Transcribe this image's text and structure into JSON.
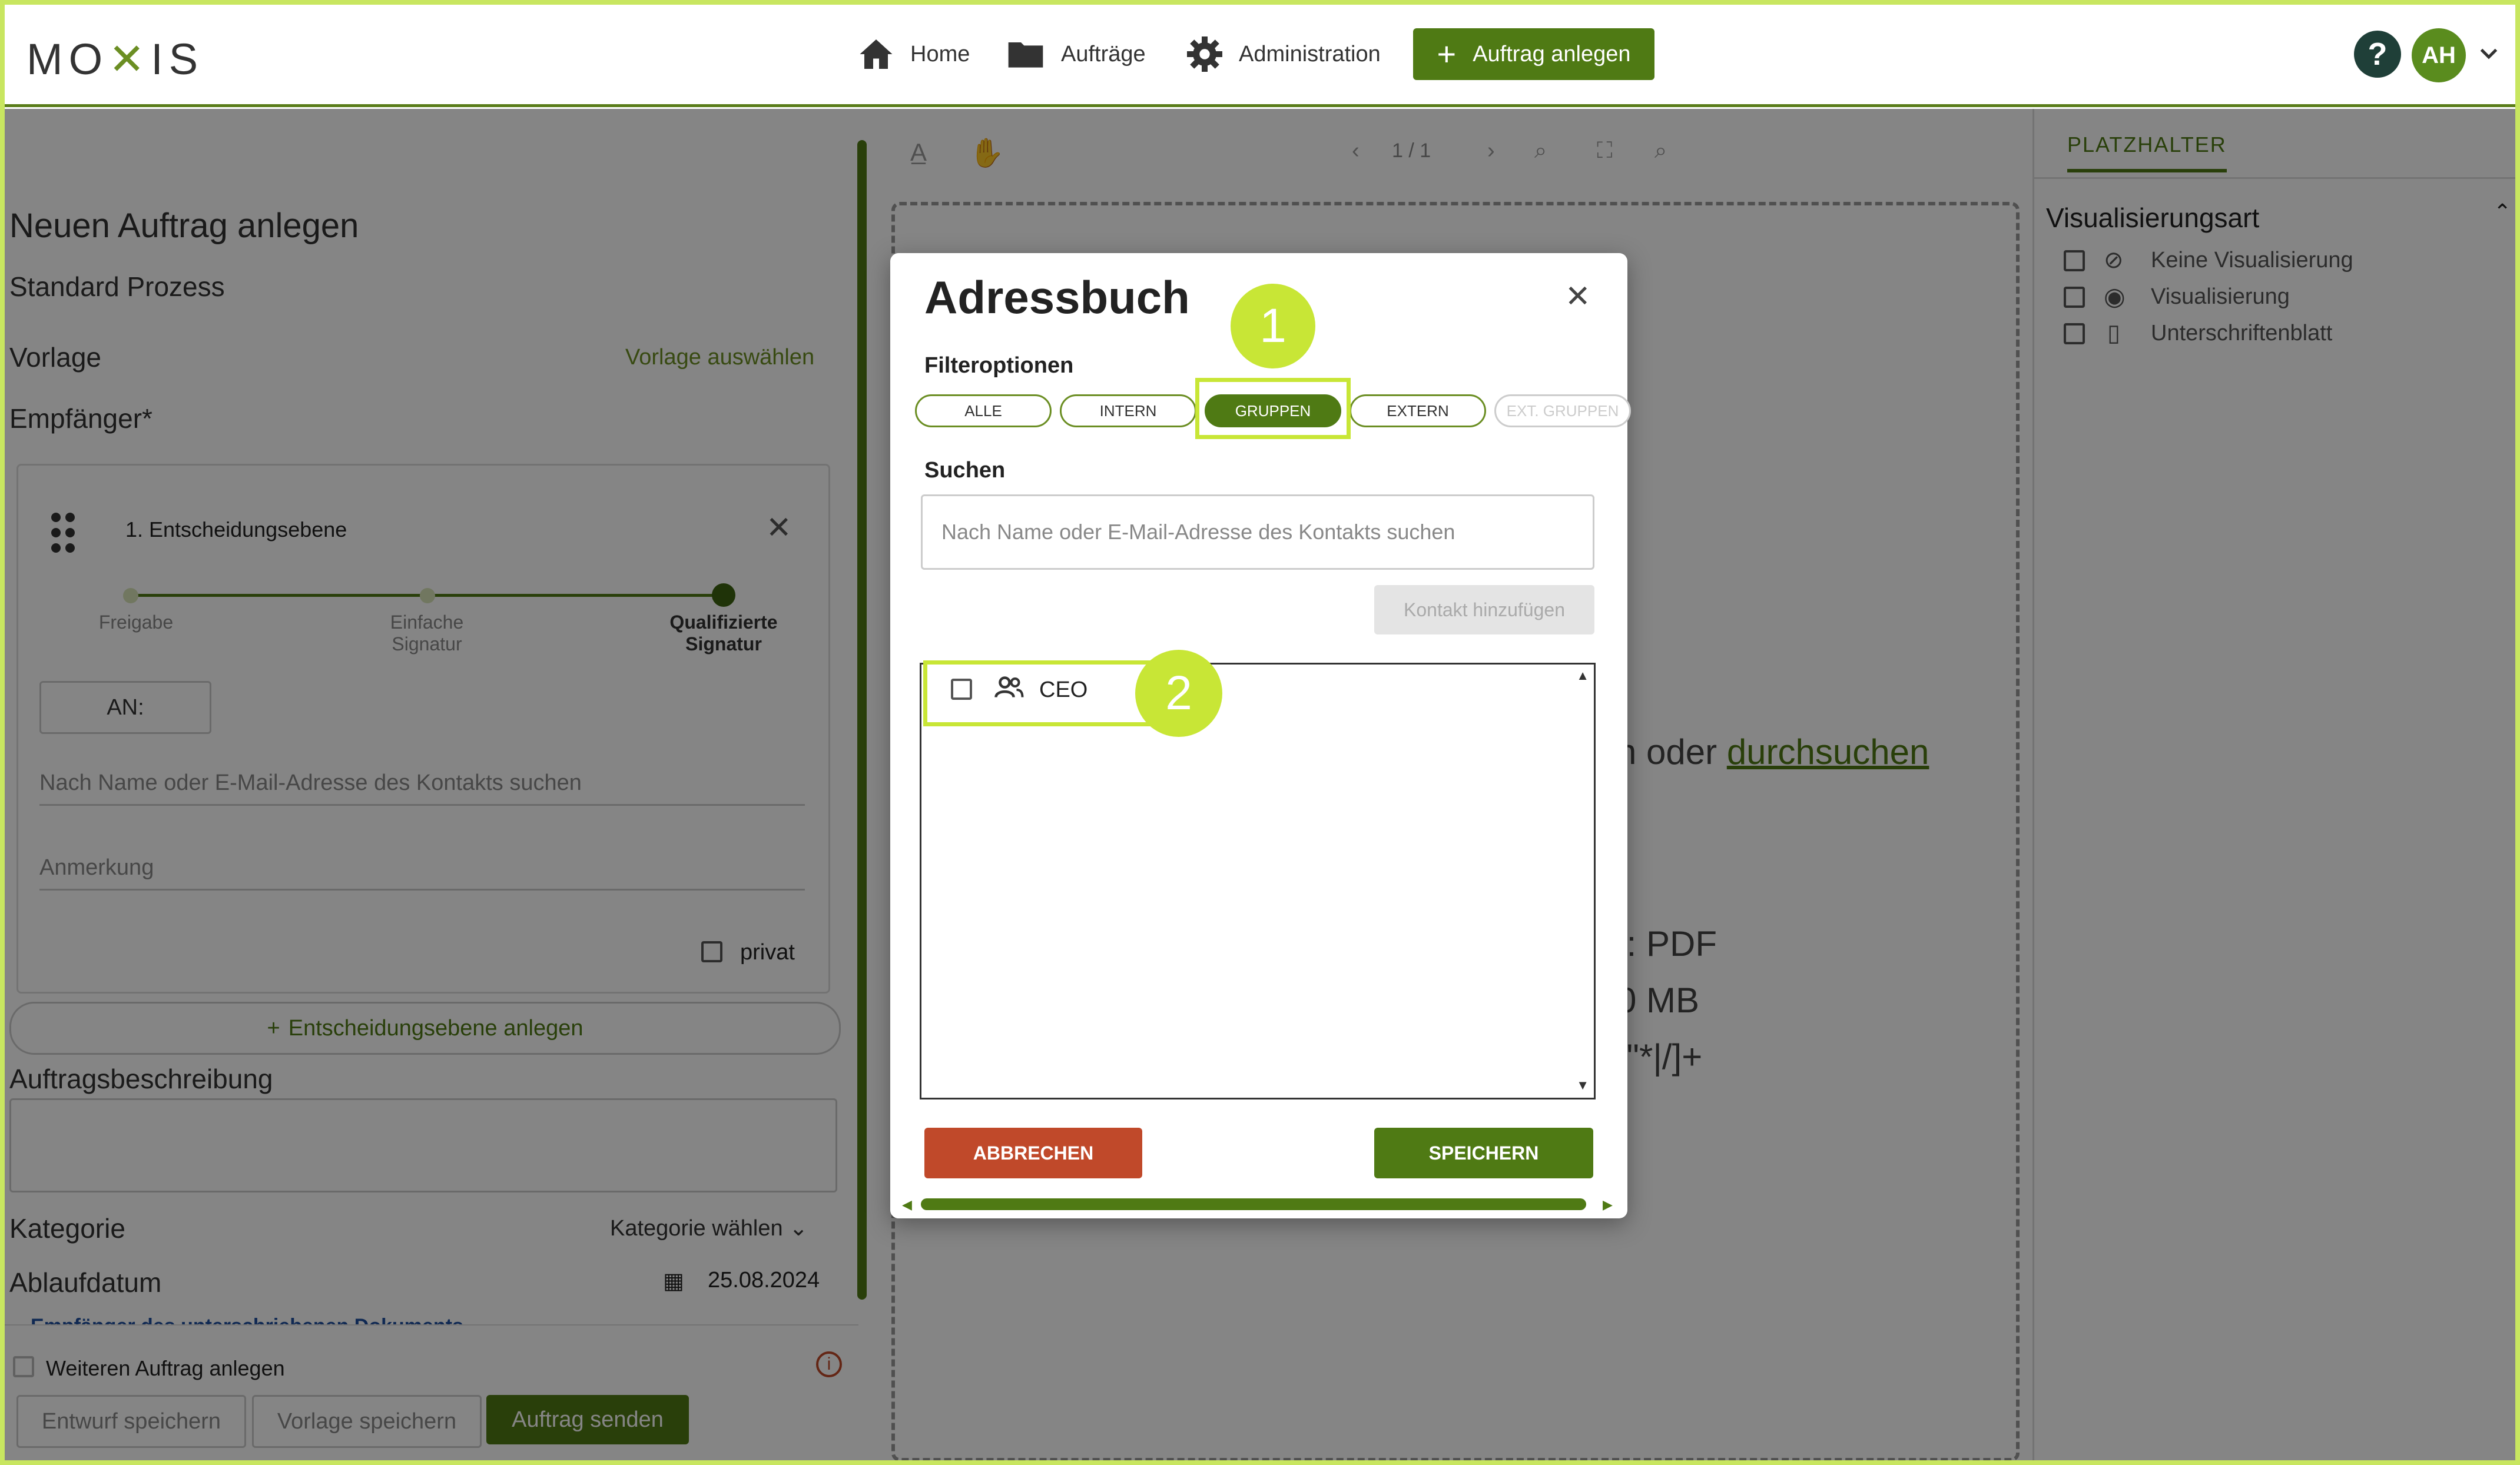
{
  "header": {
    "logo": "MOXIS",
    "nav": {
      "home": "Home",
      "auftraege": "Aufträge",
      "administration": "Administration",
      "create": "Auftrag anlegen"
    },
    "help": "?",
    "avatar": "AH"
  },
  "left": {
    "title": "Neuen Auftrag anlegen",
    "subtitle": "Standard Prozess",
    "vorlage_label": "Vorlage",
    "vorlage_link": "Vorlage auswählen",
    "empfaenger_label": "Empfänger*",
    "level": {
      "title": "1. Entscheidungsebene",
      "steps": [
        "Freigabe",
        "Einfache Signatur",
        "Qualifizierte Signatur"
      ],
      "an_label": "AN:",
      "search_placeholder": "Nach Name oder E-Mail-Adresse des Kontakts suchen",
      "anmerkung_placeholder": "Anmerkung",
      "privat_label": "privat"
    },
    "add_level": "Entscheidungsebene anlegen",
    "beschreibung_label": "Auftragsbeschreibung",
    "kategorie_label": "Kategorie",
    "kategorie_value": "Kategorie wählen",
    "ablauf_label": "Ablaufdatum",
    "ablauf_value": "25.08.2024",
    "empfaenger_doc": "Empfänger des unterschriebenen Dokuments",
    "weiteren": "Weiteren Auftrag anlegen",
    "btn_entwurf": "Entwurf speichern",
    "btn_vorlage": "Vorlage speichern",
    "btn_senden": "Auftrag senden"
  },
  "viewer": {
    "page": "1 / 1",
    "upload_tail": "n oder",
    "upload_link": "durchsuchen",
    "format_tail": "t: PDF",
    "size_tail": "0 MB",
    "chars_tail": "\\\"*|/]+"
  },
  "right": {
    "tab": "PLATZHALTER",
    "section": "Visualisierungsart",
    "options": [
      "Keine Visualisierung",
      "Visualisierung",
      "Unterschriftenblatt"
    ]
  },
  "dialog": {
    "title": "Adressbuch",
    "filter_label": "Filteroptionen",
    "filters": [
      "ALLE",
      "INTERN",
      "GRUPPEN",
      "EXTERN",
      "EXT. GRUPPEN"
    ],
    "search_label": "Suchen",
    "search_placeholder": "Nach Name oder E-Mail-Adresse des Kontakts suchen",
    "add_contact": "Kontakt hinzufügen",
    "contacts": [
      "CEO"
    ],
    "cancel": "ABBRECHEN",
    "save": "SPEICHERN"
  },
  "markers": [
    "1",
    "2"
  ],
  "colors": {
    "accent": "#4f7a14",
    "marker": "#c8e636",
    "cancel": "#c0492a",
    "overlay": "rgba(0,0,0,0.48)"
  }
}
